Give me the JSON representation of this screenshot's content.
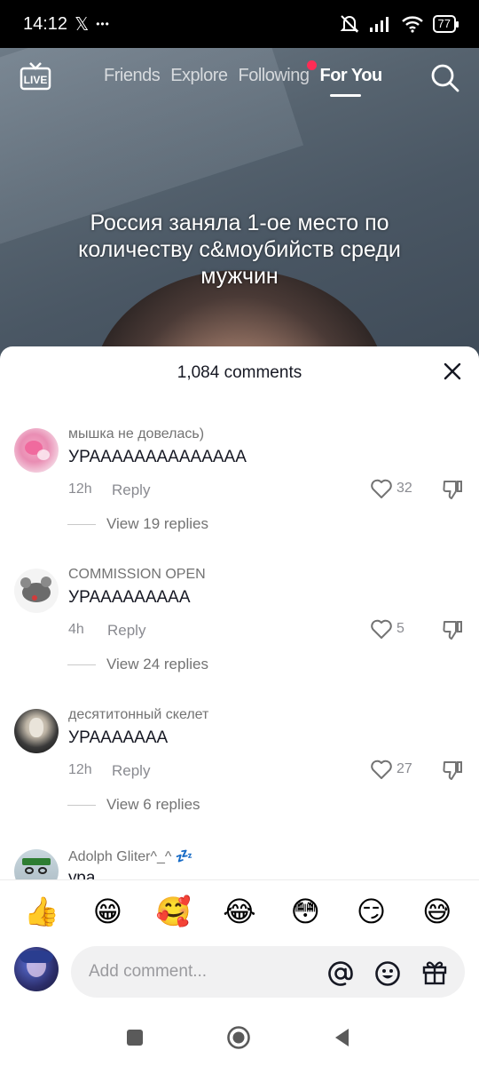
{
  "status_bar": {
    "time": "14:12",
    "x_glyph": "𝕏",
    "dots": "•••",
    "battery": "77"
  },
  "top_nav": {
    "live_label": "LIVE",
    "tabs": [
      {
        "label": "Friends",
        "active": false
      },
      {
        "label": "Explore",
        "active": false
      },
      {
        "label": "Following",
        "active": false,
        "has_dot": true
      },
      {
        "label": "For You",
        "active": true
      }
    ]
  },
  "video": {
    "caption": "Россия заняла 1-ое место по количеству с&моубийств среди мужчин"
  },
  "comments_sheet": {
    "title": "1,084 comments",
    "comments": [
      {
        "username": "мышка не довелась)",
        "text": "УРАААААААААААААА",
        "time": "12h",
        "reply_label": "Reply",
        "likes": "32",
        "view_replies": "View 19 replies"
      },
      {
        "username": "COMMISSION OPEN",
        "text": "УРААААААААА",
        "time": "4h",
        "reply_label": "Reply",
        "likes": "5",
        "view_replies": "View 24 replies"
      },
      {
        "username": "десятитонный скелет",
        "text": "УРААААААА",
        "time": "12h",
        "reply_label": "Reply",
        "likes": "27",
        "view_replies": "View 6 replies"
      },
      {
        "username": "Adolph Gliter^_^ 💤",
        "text": "ура"
      }
    ],
    "quick_emojis": [
      "👍",
      "😁",
      "🥰",
      "😂",
      "😳",
      "😏",
      "😅"
    ],
    "input": {
      "placeholder": "Add comment..."
    }
  },
  "colors": {
    "accent_dot": "#fe2c55",
    "text_primary": "#161823",
    "text_secondary": "#8a8b91"
  }
}
